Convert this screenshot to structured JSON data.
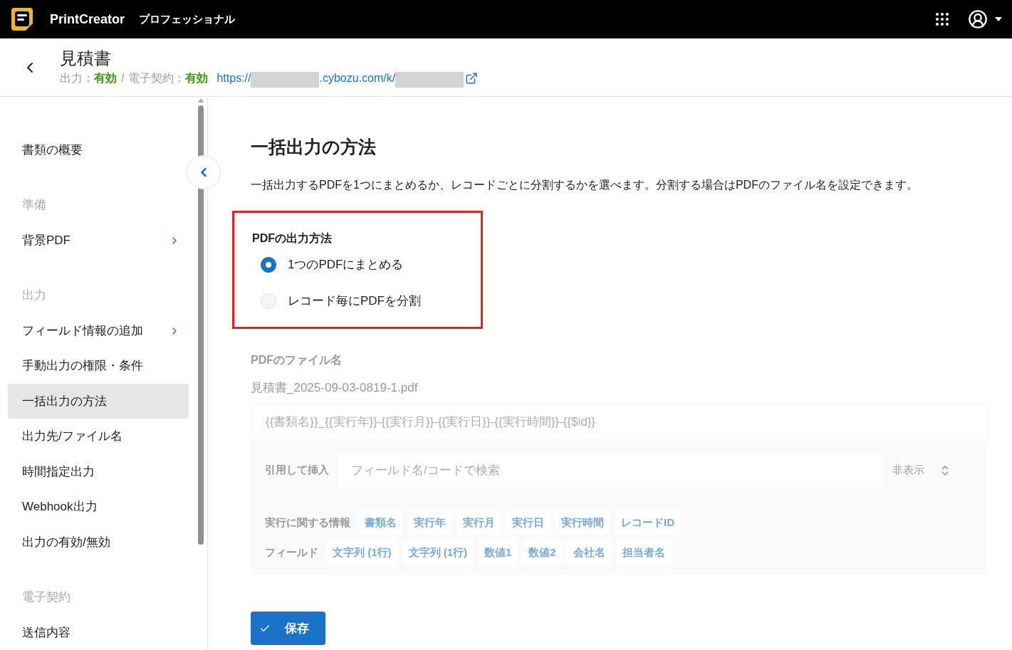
{
  "app": {
    "name": "PrintCreator",
    "edition": "プロフェッショナル"
  },
  "header": {
    "title": "見積書",
    "status": [
      {
        "label": "出力：",
        "value": "有効"
      },
      {
        "label": "電子契約：",
        "value": "有効"
      }
    ],
    "separator": "/",
    "url_parts": [
      {
        "kind": "text",
        "text": "https://"
      },
      {
        "kind": "redacted"
      },
      {
        "kind": "text",
        "text": ".cybozu.com/k/"
      },
      {
        "kind": "redacted"
      }
    ]
  },
  "sidebar": {
    "items": [
      {
        "kind": "item",
        "label": "書類の概要",
        "selected": false,
        "submenu": false
      },
      {
        "kind": "section",
        "label": "準備"
      },
      {
        "kind": "item",
        "label": "背景PDF",
        "selected": false,
        "submenu": true
      },
      {
        "kind": "section",
        "label": "出力"
      },
      {
        "kind": "item",
        "label": "フィールド情報の追加",
        "selected": false,
        "submenu": true
      },
      {
        "kind": "item",
        "label": "手動出力の権限・条件",
        "selected": false,
        "submenu": false
      },
      {
        "kind": "item",
        "label": "一括出力の方法",
        "selected": true,
        "submenu": false
      },
      {
        "kind": "item",
        "label": "出力先/ファイル名",
        "selected": false,
        "submenu": false
      },
      {
        "kind": "item",
        "label": "時間指定出力",
        "selected": false,
        "submenu": false
      },
      {
        "kind": "item",
        "label": "Webhook出力",
        "selected": false,
        "submenu": false
      },
      {
        "kind": "item",
        "label": "出力の有効/無効",
        "selected": false,
        "submenu": false
      },
      {
        "kind": "section",
        "label": "電子契約"
      },
      {
        "kind": "item",
        "label": "送信内容",
        "selected": false,
        "submenu": false
      }
    ]
  },
  "main": {
    "title": "一括出力の方法",
    "description": "一括出力するPDFを1つにまとめるか、レコードごとに分割するかを選べます。分割する場合はPDFのファイル名を設定できます。",
    "output_method": {
      "title": "PDFの出力方法",
      "highlighted": true,
      "options": [
        {
          "label": "1つのPDFにまとめる",
          "selected": true
        },
        {
          "label": "レコード毎にPDFを分割",
          "selected": false
        }
      ]
    },
    "file_name": {
      "disabled": true,
      "title": "PDFのファイル名",
      "preview": "見積書_2025-09-03-0819-1.pdf",
      "template": "{{書類名}}_{{実行年}}-{{実行月}}-{{実行日}}-{{実行時間}}-{{$id}}",
      "insert_label": "引用して挿入",
      "search_placeholder": "フィールド名/コードで検索",
      "hide_label": "非表示",
      "chip_groups": [
        {
          "label": "実行に関する情報",
          "chips": [
            "書類名",
            "実行年",
            "実行月",
            "実行日",
            "実行時間",
            "レコードID"
          ]
        },
        {
          "label": "フィールド",
          "chips": [
            "文字列 (1行)",
            "文字列 (1行)",
            "数値1",
            "数値2",
            "会社名",
            "担当者名"
          ]
        }
      ]
    },
    "save_button": "保存"
  }
}
